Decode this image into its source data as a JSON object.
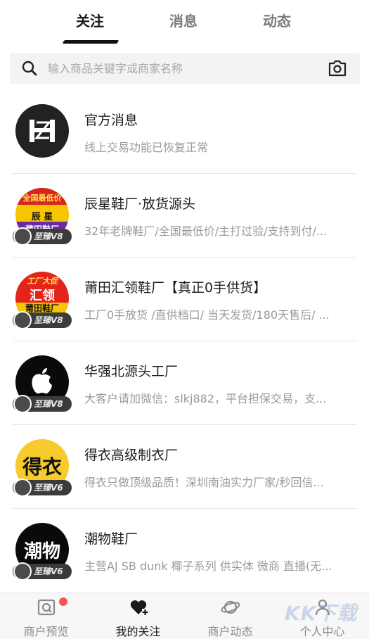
{
  "tabs": [
    {
      "label": "关注",
      "active": true
    },
    {
      "label": "消息",
      "active": false
    },
    {
      "label": "动态",
      "active": false
    }
  ],
  "search": {
    "placeholder": "输入商品关键字或商家名称"
  },
  "merchants": [
    {
      "name": "官方消息",
      "desc": "线上交易功能已恢复正常",
      "avatar_text": "H",
      "badge": ""
    },
    {
      "name": "辰星鞋厂·放货源头",
      "desc": "32年老牌鞋厂/全国最低价/主打过验/支持到付/...",
      "avatar_top": "全国最低价",
      "avatar_mid": "辰  星",
      "avatar_bot": "莆田鞋厂",
      "badge": "至臻V8"
    },
    {
      "name": "莆田汇领鞋厂【真正0手供货】",
      "desc": " 工厂0手放货 /直供档口/ 当天发货/180天售后/ ...",
      "avatar_top": "工厂大促",
      "avatar_mid": "汇领",
      "avatar_bot": "莆田鞋厂",
      "badge": "至臻V8"
    },
    {
      "name": "华强北源头工厂",
      "desc": "大客户请加微信：slkj882，平台担保交易，支...",
      "badge": "至臻V8"
    },
    {
      "name": "得衣高级制衣厂",
      "desc": "得衣只做顶级品质！深圳南油实力厂家/秒回信...",
      "avatar_text": "得衣",
      "badge": "至臻V6"
    },
    {
      "name": "潮物鞋厂",
      "desc": " 主营AJ SB dunk 椰子系列 供实体 微商 直播(无...",
      "avatar_text": "潮物",
      "badge": "至臻V6"
    }
  ],
  "bottom_nav": [
    {
      "label": "商户预览",
      "icon": "store-preview-icon",
      "active": false,
      "dot": true
    },
    {
      "label": "我的关注",
      "icon": "heart-plus-icon",
      "active": true
    },
    {
      "label": "商户动态",
      "icon": "planet-icon",
      "active": false
    },
    {
      "label": "个人中心",
      "icon": "user-icon",
      "active": false
    }
  ],
  "watermark": "KK下载"
}
